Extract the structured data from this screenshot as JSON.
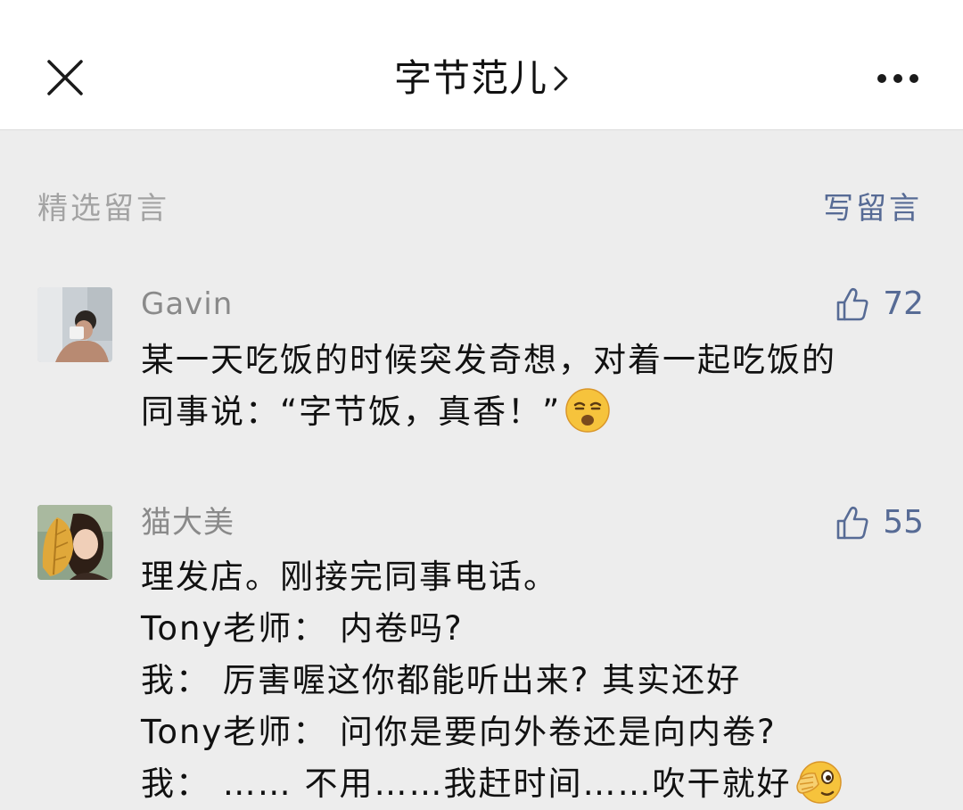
{
  "header": {
    "title": "字节范儿",
    "close_icon": "close-icon",
    "more_icon": "more-dots-icon",
    "chevron_icon": "chevron-right-icon"
  },
  "comments_section": {
    "label": "精选留言",
    "write_label": "写留言"
  },
  "comments": [
    {
      "name": "Gavin",
      "likes": "72",
      "lines": [
        "某一天吃饭的时候突发奇想，对着一起吃饭的",
        "同事说：“字节饭，真香！”"
      ],
      "emoji": "sleepy-smirk-emoji"
    },
    {
      "name": "猫大美",
      "likes": "55",
      "lines": [
        "理发店。刚接完同事电话。",
        "Tony老师： 内卷吗?",
        "我： 厉害喔这你都能听出来? 其实还好",
        "Tony老师： 问你是要向外卷还是向内卷?",
        "我： …… 不用……我赶时间……吹干就好"
      ],
      "emoji": "facepalm-emoji"
    }
  ],
  "colors": {
    "background": "#ededed",
    "header_bg": "#ffffff",
    "link": "#576b95",
    "muted": "#a3a3a3",
    "text": "#111111"
  }
}
